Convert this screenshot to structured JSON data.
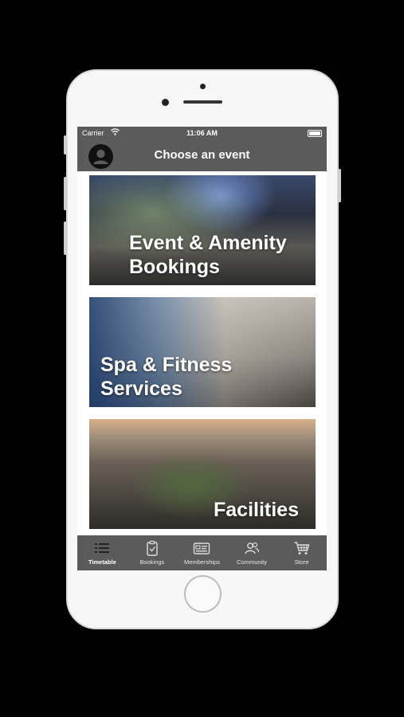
{
  "status_bar": {
    "carrier": "Carrier",
    "time": "11:06 AM"
  },
  "header": {
    "title": "Choose an event",
    "avatar_icon": "user-avatar-icon"
  },
  "cards": [
    {
      "label": "Event & Amenity\nBookings"
    },
    {
      "label": "Spa & Fitness\nServices"
    },
    {
      "label": "Facilities"
    }
  ],
  "tabs": [
    {
      "label": "Timetable",
      "icon": "list-icon",
      "active": true
    },
    {
      "label": "Bookings",
      "icon": "clipboard-check-icon",
      "active": false
    },
    {
      "label": "Memberships",
      "icon": "membership-card-icon",
      "active": false
    },
    {
      "label": "Community",
      "icon": "people-icon",
      "active": false
    },
    {
      "label": "Store",
      "icon": "cart-icon",
      "active": false
    }
  ],
  "colors": {
    "bar_background": "#5b5b5b",
    "text_light": "#ffffff"
  }
}
